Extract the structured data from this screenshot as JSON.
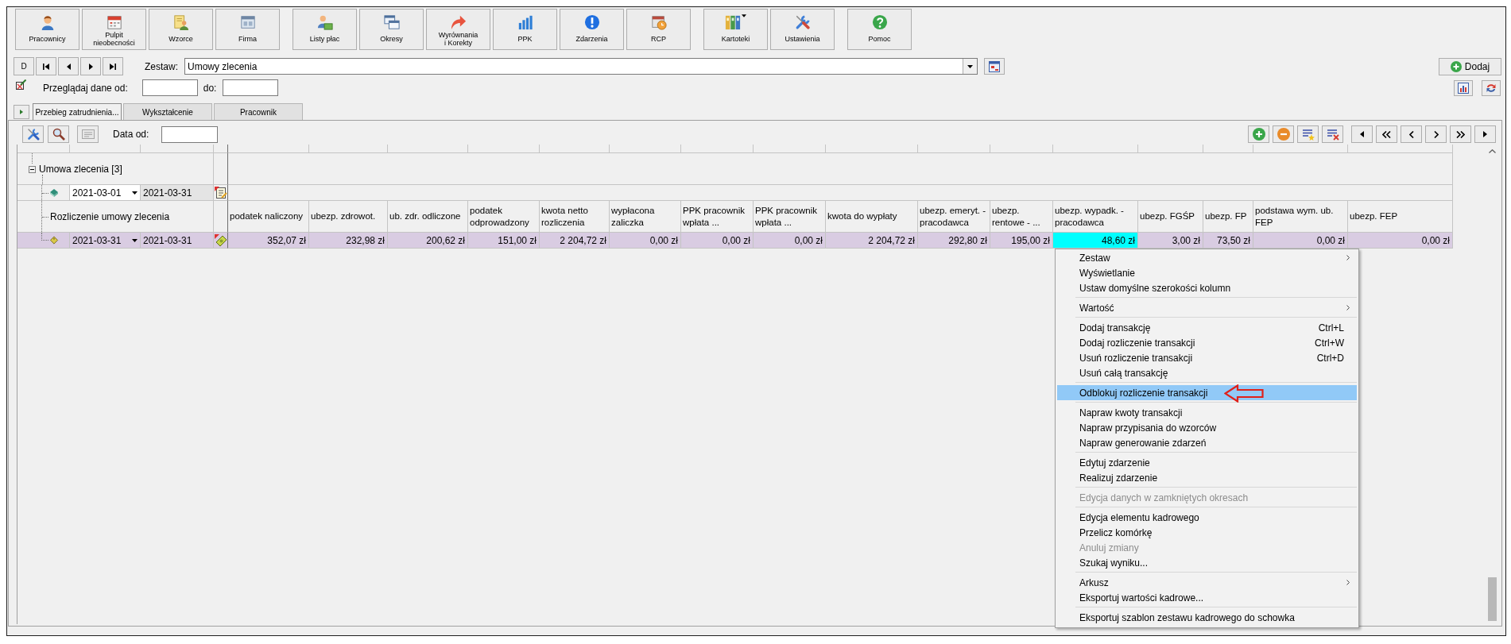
{
  "toolbar": {
    "groups": [
      [
        {
          "label": "Pracownicy",
          "dropdown": false
        },
        {
          "label": "Pulpit\nnieobecności",
          "dropdown": false
        },
        {
          "label": "Wzorce",
          "dropdown": false
        },
        {
          "label": "Firma",
          "dropdown": false
        }
      ],
      [
        {
          "label": "Listy płac",
          "dropdown": false
        },
        {
          "label": "Okresy",
          "dropdown": false
        },
        {
          "label": "Wyrównania\ni Korekty",
          "dropdown": false
        },
        {
          "label": "PPK",
          "dropdown": false
        },
        {
          "label": "Zdarzenia",
          "dropdown": false
        },
        {
          "label": "RCP",
          "dropdown": false
        }
      ],
      [
        {
          "label": "Kartoteki",
          "dropdown": true
        },
        {
          "label": "Ustawienia",
          "dropdown": false
        }
      ],
      [
        {
          "label": "Pomoc",
          "dropdown": false
        }
      ]
    ]
  },
  "record_bar": {
    "first_button": "D",
    "set_label": "Zestaw:",
    "set_value": "Umowy zlecenia",
    "add_button": "Dodaj"
  },
  "date_filter": {
    "from_label": "Przeglądaj dane od:",
    "to_label": "do:"
  },
  "tabs": [
    {
      "label": "Przebieg zatrudnienia...",
      "selected": true
    },
    {
      "label": "Wykształcenie",
      "selected": false
    },
    {
      "label": "Pracownik",
      "selected": false
    }
  ],
  "panel_toolbar": {
    "date_label": "Data od:"
  },
  "grid": {
    "group": {
      "label": "Umowa zlecenia [3]",
      "expanded": true
    },
    "period": {
      "from": "2021-03-01",
      "to": "2021-03-31"
    },
    "section_label": "Rozliczenie umowy zlecenia",
    "columns": [
      "podatek naliczony",
      "ubezp. zdrowot.",
      "ub. zdr. odliczone",
      "podatek odprowadzony",
      "kwota netto rozliczenia",
      "wypłacona zaliczka",
      "PPK pracownik wpłata ...",
      "PPK pracownik wpłata ...",
      "kwota do wypłaty",
      "ubezp. emeryt. - pracodawca",
      "ubezp. rentowe - ...",
      "ubezp. wypadk. - pracodawca",
      "ubezp. FGŚP",
      "ubezp. FP",
      "podstawa wym. ub. FEP",
      "ubezp. FEP"
    ],
    "rows": [
      {
        "from": "2021-03-31",
        "to": "2021-03-31",
        "selected": true,
        "cells": [
          {
            "value": "352,07 zł",
            "selected": false
          },
          {
            "value": "232,98 zł",
            "selected": false
          },
          {
            "value": "200,62 zł",
            "selected": false
          },
          {
            "value": "151,00 zł",
            "selected": false
          },
          {
            "value": "2 204,72 zł",
            "selected": false
          },
          {
            "value": "0,00 zł",
            "selected": false
          },
          {
            "value": "0,00 zł",
            "selected": false
          },
          {
            "value": "0,00 zł",
            "selected": false
          },
          {
            "value": "2 204,72 zł",
            "selected": false
          },
          {
            "value": "292,80 zł",
            "selected": false
          },
          {
            "value": "195,00 zł",
            "selected": false
          },
          {
            "value": "48,60 zł",
            "selected": true
          },
          {
            "value": "3,00 zł",
            "selected": false
          },
          {
            "value": "73,50 zł",
            "selected": false
          },
          {
            "value": "0,00 zł",
            "selected": false
          },
          {
            "value": "0,00 zł",
            "selected": false
          }
        ]
      }
    ]
  },
  "context_menu": {
    "sections": [
      [
        {
          "label": "Zestaw",
          "submenu": true,
          "disabled": false,
          "selected": false
        },
        {
          "label": "Wyświetlanie",
          "submenu": false,
          "disabled": false,
          "selected": false
        },
        {
          "label": "Ustaw domyślne szerokości kolumn",
          "submenu": false,
          "disabled": false,
          "selected": false
        }
      ],
      [
        {
          "label": "Wartość",
          "submenu": true,
          "disabled": false,
          "selected": false
        }
      ],
      [
        {
          "label": "Dodaj transakcję",
          "shortcut": "Ctrl+L",
          "submenu": false,
          "disabled": false,
          "selected": false
        },
        {
          "label": "Dodaj rozliczenie transakcji",
          "shortcut": "Ctrl+W",
          "submenu": false,
          "disabled": false,
          "selected": false
        },
        {
          "label": "Usuń rozliczenie transakcji",
          "shortcut": "Ctrl+D",
          "submenu": false,
          "disabled": false,
          "selected": false
        },
        {
          "label": "Usuń całą transakcję",
          "submenu": false,
          "disabled": false,
          "selected": false
        }
      ],
      [
        {
          "label": "Odblokuj rozliczenie transakcji",
          "submenu": false,
          "disabled": false,
          "selected": true
        }
      ],
      [
        {
          "label": "Napraw kwoty transakcji",
          "submenu": false,
          "disabled": false,
          "selected": false
        },
        {
          "label": "Napraw przypisania do wzorców",
          "submenu": false,
          "disabled": false,
          "selected": false
        },
        {
          "label": "Napraw generowanie zdarzeń",
          "submenu": false,
          "disabled": false,
          "selected": false
        }
      ],
      [
        {
          "label": "Edytuj zdarzenie",
          "submenu": false,
          "disabled": false,
          "selected": false
        },
        {
          "label": "Realizuj zdarzenie",
          "submenu": false,
          "disabled": false,
          "selected": false
        }
      ],
      [
        {
          "label": "Edycja danych w zamkniętych okresach",
          "submenu": false,
          "disabled": true,
          "selected": false
        }
      ],
      [
        {
          "label": "Edycja elementu kadrowego",
          "submenu": false,
          "disabled": false,
          "selected": false
        },
        {
          "label": "Przelicz komórkę",
          "submenu": false,
          "disabled": false,
          "selected": false
        },
        {
          "label": "Anuluj zmiany",
          "submenu": false,
          "disabled": true,
          "selected": false
        },
        {
          "label": "Szukaj wyniku...",
          "submenu": false,
          "disabled": false,
          "selected": false
        }
      ],
      [
        {
          "label": "Arkusz",
          "submenu": true,
          "disabled": false,
          "selected": false
        },
        {
          "label": "Eksportuj wartości kadrowe...",
          "submenu": false,
          "disabled": false,
          "selected": false
        }
      ],
      [
        {
          "label": "Eksportuj szablon zestawu kadrowego do schowka",
          "submenu": false,
          "disabled": false,
          "selected": false
        }
      ]
    ]
  }
}
